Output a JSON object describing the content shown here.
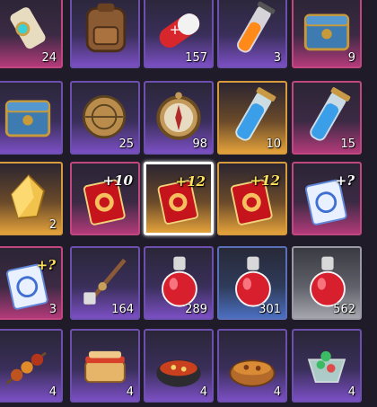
{
  "inventory": {
    "rows": [
      [
        {
          "name": "scroll-item",
          "rarity": "pink",
          "count": "24"
        },
        {
          "name": "backpack-item",
          "rarity": "purple",
          "count": ""
        },
        {
          "name": "capsule-pill-item",
          "rarity": "purple",
          "count": "157"
        },
        {
          "name": "potion-vial-item",
          "rarity": "purple",
          "count": "3"
        },
        {
          "name": "treasure-chest-item",
          "rarity": "pink",
          "count": "9"
        }
      ],
      [
        {
          "name": "treasure-chest-item",
          "rarity": "purple",
          "count": ""
        },
        {
          "name": "astrolabe-item",
          "rarity": "purple",
          "count": "25"
        },
        {
          "name": "compass-item",
          "rarity": "purple",
          "count": "98"
        },
        {
          "name": "blue-vial-item",
          "rarity": "gold",
          "count": "10"
        },
        {
          "name": "blue-vial-item",
          "rarity": "pink",
          "count": "15"
        }
      ],
      [
        {
          "name": "gold-crystal-item",
          "rarity": "gold",
          "count": "2"
        },
        {
          "name": "red-ticket-item",
          "rarity": "pink",
          "count": "",
          "plus": "+10",
          "plus_color": "#ffffff"
        },
        {
          "name": "red-ticket-item",
          "rarity": "gold",
          "count": "",
          "plus": "+12",
          "plus_color": "#ffe15a",
          "selected": true
        },
        {
          "name": "red-ticket-item",
          "rarity": "gold",
          "count": "",
          "plus": "+12",
          "plus_color": "#ffe15a"
        },
        {
          "name": "blue-ticket-item",
          "rarity": "pink",
          "count": "",
          "plus": "+?",
          "plus_color": "#ffffff"
        }
      ],
      [
        {
          "name": "blue-ticket-item",
          "rarity": "pink",
          "count": "3",
          "plus": "+?",
          "plus_color": "#ffe15a"
        },
        {
          "name": "sword-ornament-item",
          "rarity": "purple",
          "count": "164"
        },
        {
          "name": "red-potion-item",
          "rarity": "purple",
          "count": "289"
        },
        {
          "name": "red-potion-item",
          "rarity": "blue",
          "count": "301"
        },
        {
          "name": "red-potion-item",
          "rarity": "grey",
          "count": "562"
        }
      ],
      [
        {
          "name": "skewer-food-item",
          "rarity": "purple",
          "count": "4"
        },
        {
          "name": "sandwich-food-item",
          "rarity": "purple",
          "count": "4"
        },
        {
          "name": "stew-pot-item",
          "rarity": "purple",
          "count": "4"
        },
        {
          "name": "soup-bowl-item",
          "rarity": "purple",
          "count": "4"
        },
        {
          "name": "jelly-dessert-item",
          "rarity": "purple",
          "count": "4"
        }
      ]
    ]
  }
}
